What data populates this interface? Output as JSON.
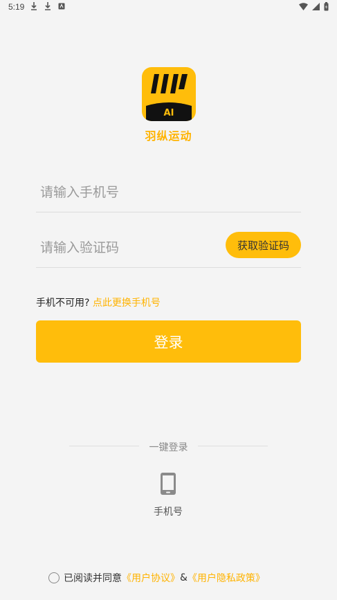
{
  "status_bar": {
    "time": "5:19"
  },
  "app": {
    "logo_badge": "AI",
    "name": "羽纵运动"
  },
  "login_form": {
    "phone_placeholder": "请输入手机号",
    "phone_value": "",
    "code_placeholder": "请输入验证码",
    "code_value": "",
    "get_code_label": "获取验证码",
    "phone_unavailable_text": "手机不可用?",
    "change_phone_link": "点此更换手机号",
    "login_label": "登录"
  },
  "one_key": {
    "section_label": "一键登录",
    "phone_option_label": "手机号"
  },
  "agreement": {
    "prefix": "已阅读并同意",
    "user_agreement": "《用户协议》",
    "separator": "&",
    "privacy_policy": "《用户隐私政策》"
  },
  "colors": {
    "accent": "#ffbd0b",
    "link": "#ffb300",
    "background": "#f4f4f4"
  }
}
